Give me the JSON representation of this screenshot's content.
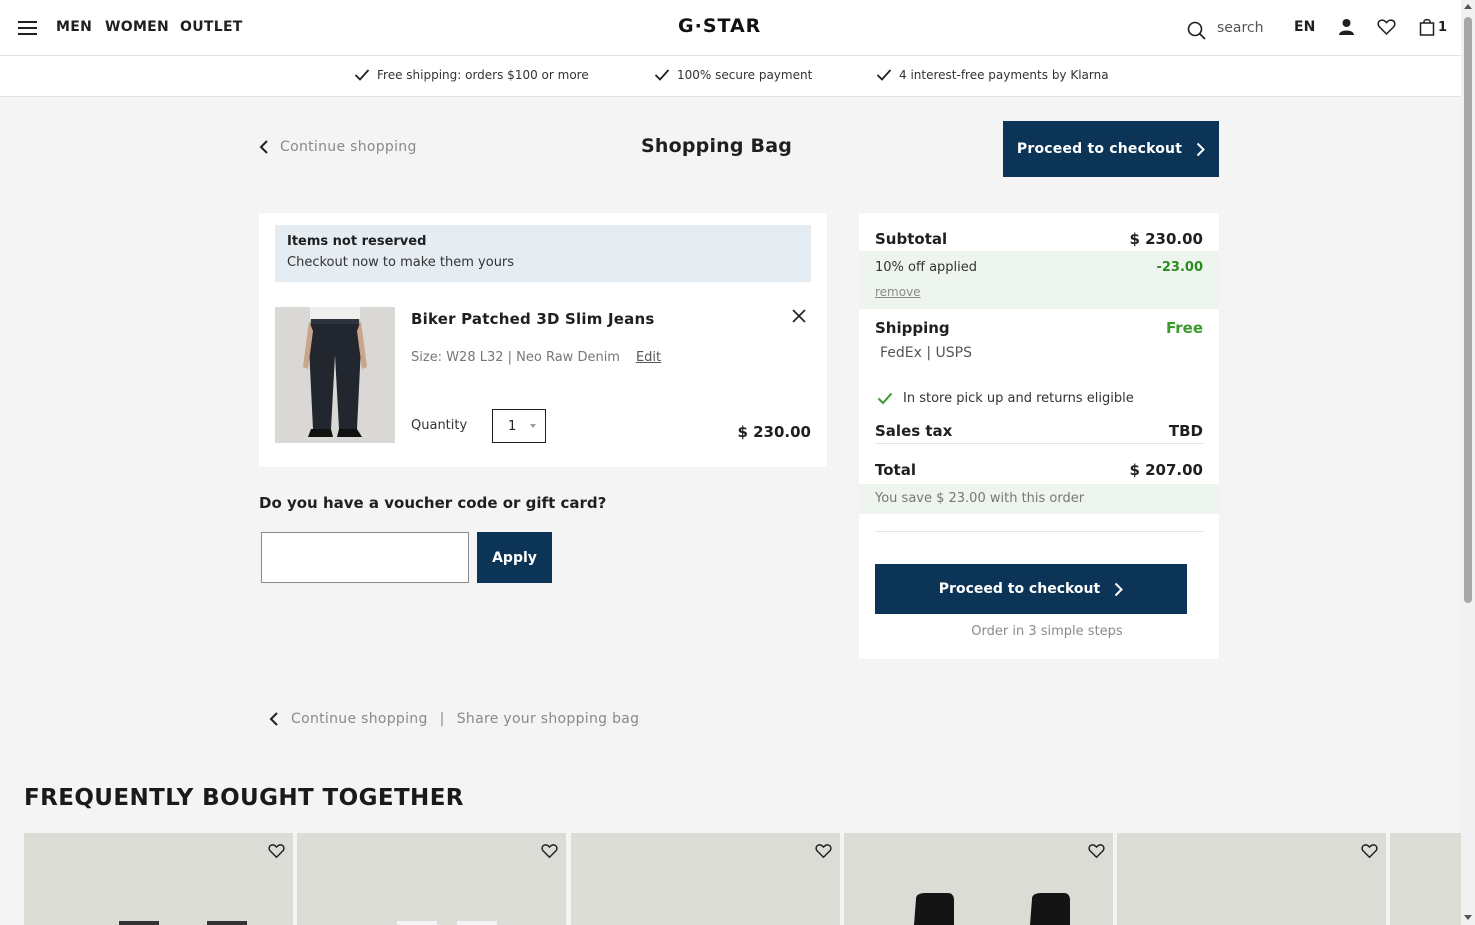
{
  "header": {
    "brand": "G·STAR",
    "nav": [
      "MEN",
      "WOMEN",
      "OUTLET"
    ],
    "search_label": "search",
    "language": "EN",
    "bag_count": "1"
  },
  "usp": [
    "Free shipping: orders $100 or more",
    "100% secure payment",
    "4 interest-free payments by Klarna"
  ],
  "bag": {
    "continue_label": "Continue shopping",
    "title": "Shopping Bag",
    "checkout_label": "Proceed to checkout"
  },
  "cart": {
    "notice_title": "Items not reserved",
    "notice_text": "Checkout now to make them yours",
    "item": {
      "name": "Biker Patched 3D Slim Jeans",
      "meta": "Size: W28 L32 | Neo Raw Denim",
      "edit_label": "Edit",
      "quantity_label": "Quantity",
      "quantity": "1",
      "price": "$ 230.00"
    }
  },
  "voucher": {
    "title": "Do you have a voucher code or gift card?",
    "input_value": "",
    "apply_label": "Apply"
  },
  "summary": {
    "subtotal_label": "Subtotal",
    "subtotal_value": "$ 230.00",
    "discount_label": "10% off applied",
    "discount_value": "-23.00",
    "remove_label": "remove",
    "shipping_label": "Shipping",
    "shipping_value": "Free",
    "carriers": "FedEx | USPS",
    "pickup_text": "In store pick up and returns eligible",
    "tax_label": "Sales tax",
    "tax_value": "TBD",
    "total_label": "Total",
    "total_value": "$ 207.00",
    "savings_text": "You save $ 23.00 with this order",
    "checkout_label": "Proceed to checkout",
    "steps_text": "Order in 3 simple steps"
  },
  "footer_links": {
    "continue_label": "Continue shopping",
    "separator": "|",
    "share_label": "Share your shopping bag"
  },
  "recommendations": {
    "title": "FREQUENTLY BOUGHT TOGETHER"
  },
  "colors": {
    "primary": "#0c3457",
    "success": "#2b8a22",
    "notice_bg": "#e5ecf2",
    "discount_bg": "#eef5ee"
  }
}
